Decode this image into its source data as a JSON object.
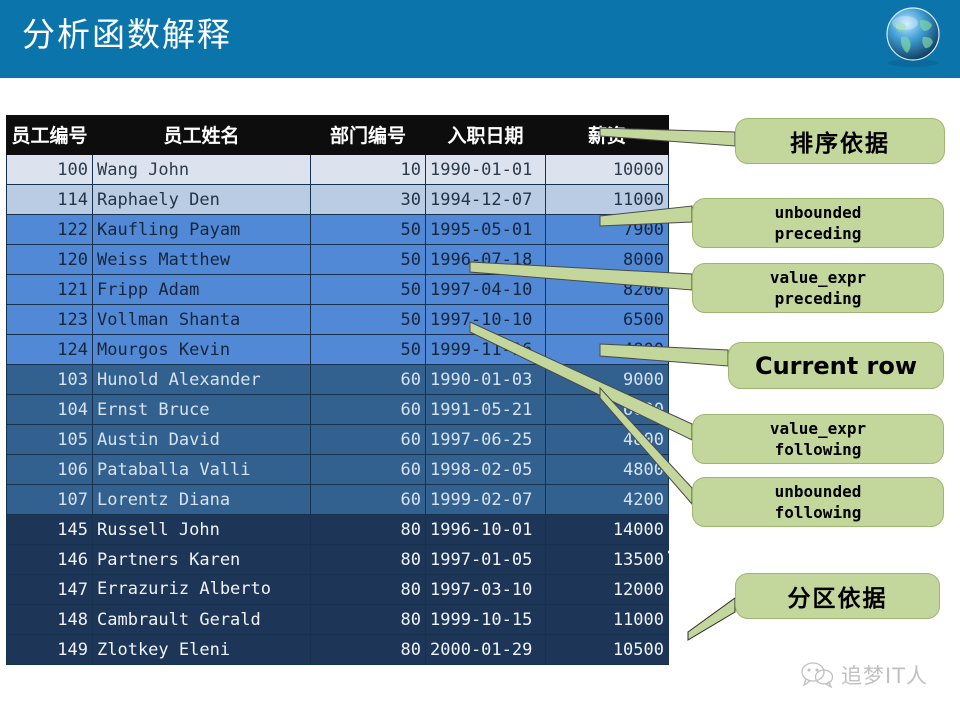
{
  "header": {
    "title": "分析函数解释",
    "band_color": "#0b75ab",
    "globe_icon": "globe-icon"
  },
  "table": {
    "columns": [
      "员工编号",
      "员工姓名",
      "部门编号",
      "入职日期",
      "薪资"
    ],
    "rows": [
      {
        "id": "100",
        "name": "Wang John",
        "dept": "10",
        "date": "1990-01-01",
        "salary": "10000",
        "group": "g1"
      },
      {
        "id": "114",
        "name": "Raphaely Den",
        "dept": "30",
        "date": "1994-12-07",
        "salary": "11000",
        "group": "g2"
      },
      {
        "id": "122",
        "name": "Kaufling Payam",
        "dept": "50",
        "date": "1995-05-01",
        "salary": "7900",
        "group": "g50"
      },
      {
        "id": "120",
        "name": "Weiss Matthew",
        "dept": "50",
        "date": "1996-07-18",
        "salary": "8000",
        "group": "g50"
      },
      {
        "id": "121",
        "name": "Fripp Adam",
        "dept": "50",
        "date": "1997-04-10",
        "salary": "8200",
        "group": "g50"
      },
      {
        "id": "123",
        "name": "Vollman Shanta",
        "dept": "50",
        "date": "1997-10-10",
        "salary": "6500",
        "group": "g50"
      },
      {
        "id": "124",
        "name": "Mourgos Kevin",
        "dept": "50",
        "date": "1999-11-16",
        "salary": "4800",
        "group": "g50"
      },
      {
        "id": "103",
        "name": "Hunold Alexander",
        "dept": "60",
        "date": "1990-01-03",
        "salary": "9000",
        "group": "g60"
      },
      {
        "id": "104",
        "name": "Ernst Bruce",
        "dept": "60",
        "date": "1991-05-21",
        "salary": "6000",
        "group": "g60"
      },
      {
        "id": "105",
        "name": "Austin David",
        "dept": "60",
        "date": "1997-06-25",
        "salary": "4800",
        "group": "g60"
      },
      {
        "id": "106",
        "name": "Pataballa Valli",
        "dept": "60",
        "date": "1998-02-05",
        "salary": "4800",
        "group": "g60"
      },
      {
        "id": "107",
        "name": "Lorentz Diana",
        "dept": "60",
        "date": "1999-02-07",
        "salary": "4200",
        "group": "g60"
      },
      {
        "id": "145",
        "name": "Russell John",
        "dept": "80",
        "date": "1996-10-01",
        "salary": "14000",
        "group": "g80"
      },
      {
        "id": "146",
        "name": "Partners Karen",
        "dept": "80",
        "date": "1997-01-05",
        "salary": "13500",
        "group": "g80"
      },
      {
        "id": "147",
        "name": "Errazuriz Alberto",
        "dept": "80",
        "date": "1997-03-10",
        "salary": "12000",
        "group": "g80",
        "wrap": true
      },
      {
        "id": "148",
        "name": "Cambrault Gerald",
        "dept": "80",
        "date": "1999-10-15",
        "salary": "11000",
        "group": "g80"
      },
      {
        "id": "149",
        "name": "Zlotkey Eleni",
        "dept": "80",
        "date": "2000-01-29",
        "salary": "10500",
        "group": "g80"
      }
    ]
  },
  "callouts": {
    "order_by": "排序依据",
    "unbounded_preceding_l1": "unbounded",
    "unbounded_preceding_l2": "preceding",
    "value_expr_preceding_l1": "value_expr",
    "value_expr_preceding_l2": "preceding",
    "current_row": "Current row",
    "value_expr_following_l1": "value_expr",
    "value_expr_following_l2": "following",
    "unbounded_following_l1": "unbounded",
    "unbounded_following_l2": "following",
    "partition_by": "分区依据"
  },
  "colors": {
    "callout_fill": "#c3d69b",
    "callout_border": "#9fb572",
    "header_blue": "#0b75ab",
    "table_header": "#0d0d0d",
    "group_10": "#dce3ee",
    "group_30": "#bacce3",
    "group_50": "#5189d6",
    "group_60": "#32608f",
    "group_80": "#1d3557"
  },
  "watermark": {
    "text": "追梦IT人",
    "icon": "wechat-icon"
  }
}
